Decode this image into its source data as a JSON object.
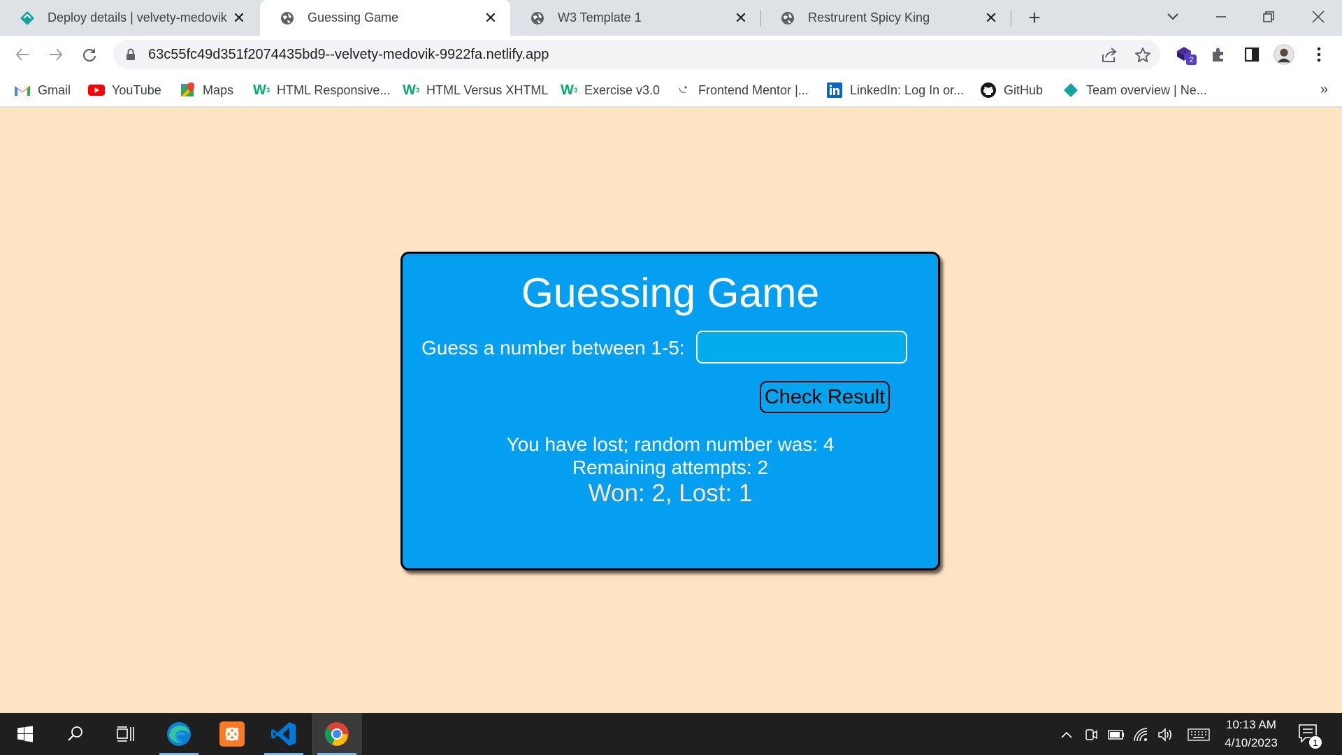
{
  "browser": {
    "tabs": [
      {
        "title": "Deploy details | velvety-medovik",
        "icon": "netlify-icon",
        "active": false
      },
      {
        "title": "Guessing Game",
        "icon": "globe-icon",
        "active": true
      },
      {
        "title": "W3 Template 1",
        "icon": "globe-icon",
        "active": false
      },
      {
        "title": "Restrurent Spicy King",
        "icon": "globe-icon",
        "active": false
      }
    ],
    "new_tab_label": "+",
    "url": "63c55fc49d351f2074435bd9--velvety-medovik-9922fa.netlify.app",
    "extension_badge": "2",
    "bookmarks": [
      {
        "label": "Gmail",
        "icon": "gmail-icon"
      },
      {
        "label": "YouTube",
        "icon": "youtube-icon"
      },
      {
        "label": "Maps",
        "icon": "maps-icon"
      },
      {
        "label": "HTML Responsive...",
        "icon": "w3schools-icon"
      },
      {
        "label": "HTML Versus XHTML",
        "icon": "w3schools-icon"
      },
      {
        "label": "Exercise v3.0",
        "icon": "w3schools-icon"
      },
      {
        "label": "Frontend Mentor |...",
        "icon": "frontend-mentor-icon"
      },
      {
        "label": "LinkedIn: Log In or...",
        "icon": "linkedin-icon"
      },
      {
        "label": "GitHub",
        "icon": "github-icon"
      },
      {
        "label": "Team overview | Ne...",
        "icon": "netlify-icon"
      }
    ],
    "bookmarks_more": "»"
  },
  "game": {
    "title": "Guessing Game",
    "prompt": "Guess a number between 1-5:",
    "input_value": "",
    "button_label": "Check Result",
    "result_message": "You have lost; random number was: 4",
    "attempts_message": "Remaining attempts: 2",
    "score_message": "Won: 2, Lost: 1"
  },
  "taskbar": {
    "apps": [
      "start-icon",
      "search-icon",
      "task-view-icon",
      "edge-icon",
      "xampp-icon",
      "vscode-icon",
      "chrome-icon"
    ],
    "time": "10:13 AM",
    "date": "4/10/2023",
    "notification_count": "1"
  },
  "colors": {
    "page_background": "#ffe4c4",
    "card_background": "#059ff1",
    "score_text": "#fde5c4"
  }
}
